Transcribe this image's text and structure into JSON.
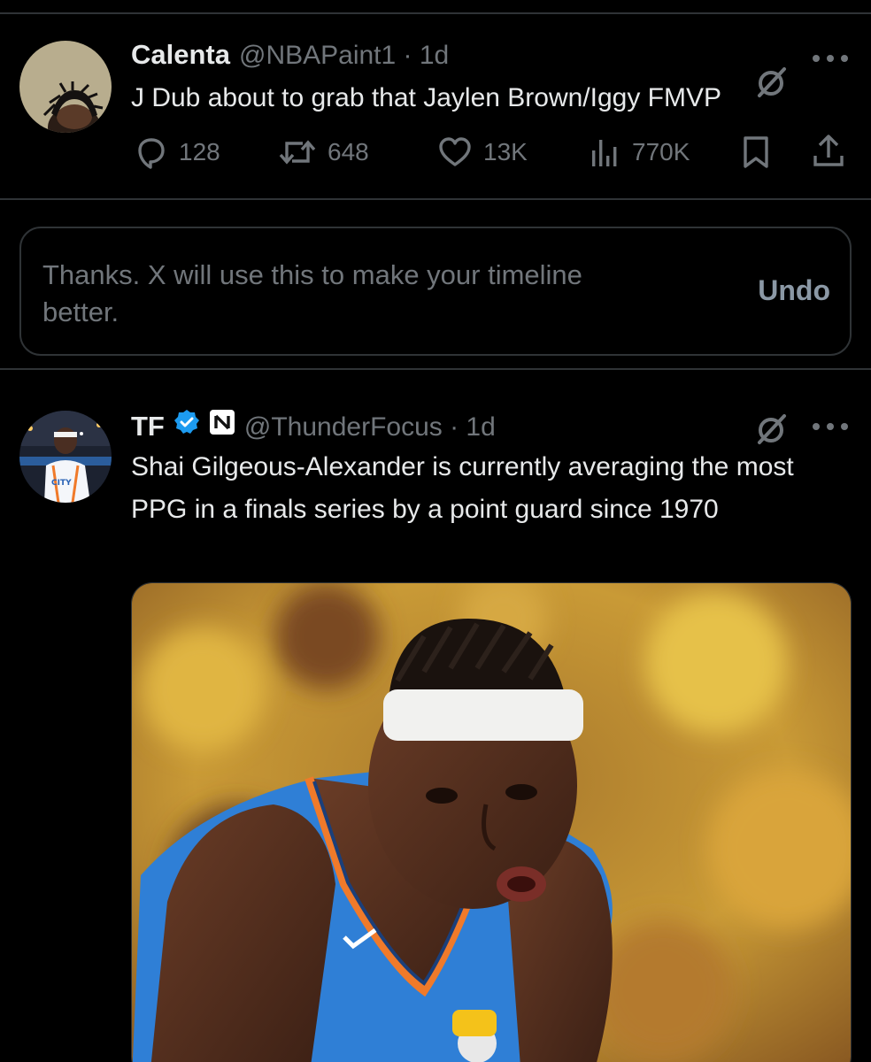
{
  "tweets": [
    {
      "display_name": "Calenta",
      "handle_meta": "@NBAPaint1 · 1d",
      "text": "J Dub about to grab that Jaylen Brown/Iggy FMVP",
      "avatar_icon": "dreadlocks-profile-avatar",
      "actions": {
        "replies": "128",
        "reposts": "648",
        "likes": "13K",
        "views": "770K"
      }
    },
    {
      "display_name": "TF",
      "handle_meta": "@ThunderFocus · 1d",
      "text": "Shai Gilgeous-Alexander is currently averaging the most PPG in a finals series by a point guard since 1970",
      "avatar_icon": "thunder-player-avatar",
      "verified": true,
      "affiliate_badge": "N"
    }
  ],
  "notice": {
    "text": "Thanks. X will use this to make your timeline better.",
    "undo_label": "Undo"
  },
  "colors": {
    "background": "#000000",
    "primary_text": "#e7e9ea",
    "secondary_text": "#71767b",
    "divider": "#2f3336",
    "verified_blue": "#1d9bf0",
    "undo_text": "#8b98a5"
  }
}
